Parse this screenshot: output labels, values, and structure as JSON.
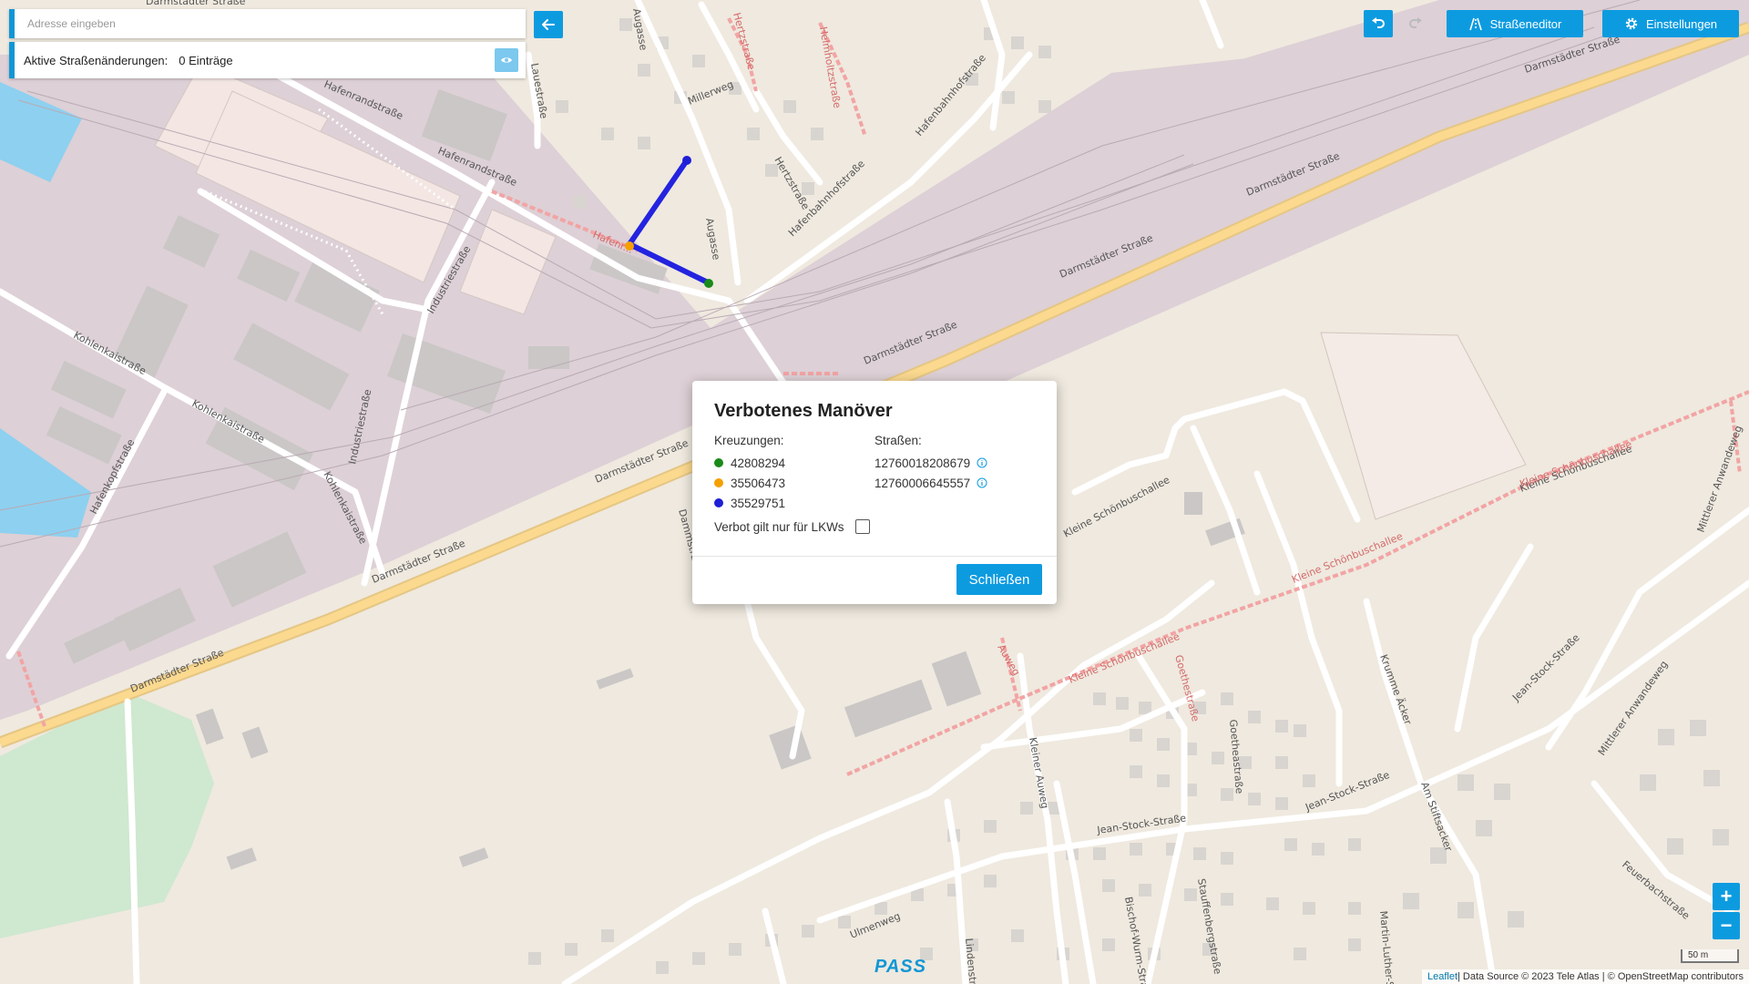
{
  "search": {
    "placeholder": "Adresse eingeben"
  },
  "changes": {
    "label": "Aktive Straßenänderungen:",
    "count": "0 Einträge"
  },
  "toolbar": {
    "editor_label": "Straßeneditor",
    "settings_label": "Einstellungen"
  },
  "modal": {
    "title": "Verbotenes Manöver",
    "crossings_label": "Kreuzungen:",
    "crossings": [
      {
        "id": "42808294",
        "color": "#1a8a1a"
      },
      {
        "id": "35506473",
        "color": "#f5a000"
      },
      {
        "id": "35529751",
        "color": "#1f1fd6"
      }
    ],
    "streets_label": "Straßen:",
    "streets": [
      "12760018208679",
      "12760006645557"
    ],
    "truck_only_label": "Verbot gilt nur für LKWs",
    "close_label": "Schließen"
  },
  "map_labels": {
    "l01": "Hafenrandstraße",
    "l02": "Hafenrandstraße",
    "l03": "Hafenr...",
    "l04": "Industriestraße",
    "l05": "Industriestraße",
    "l06": "Kohlenkaistraße",
    "l07": "Kohlenkaistraße",
    "l08": "Kohlenkaistraße",
    "l09": "Hafenkopfstraße",
    "l10": "Darmstädter Straße",
    "l11": "Darmstädter Straße",
    "l12": "Darmstädter Straße",
    "l13": "Darmstädter Straße",
    "l14": "Darmstädter Straße",
    "l15": "Darmstädter Straße",
    "l16": "Darmstädter Straße",
    "l17": "Darmstädter Straße",
    "l18": "Augasse",
    "l19": "Augasse",
    "l20": "Millerweg",
    "l21": "Hertzstraße",
    "l22": "Hertzstraße",
    "l23": "Helmholtzstraße",
    "l24": "Hafenbahnhofstraße",
    "l25": "Hafenbahnhofstraße",
    "l26": "Lauestraße",
    "l27": "Kleine Schönbuschallee",
    "l28": "Kleine Schönbuschallee",
    "l29": "Kleine Schönbuschallee",
    "l30": "Kleine Schönbuschallee",
    "l31": "Kleine Schönbuschallee",
    "l32": "Auweg",
    "l33": "Kleiner Auweg",
    "l34": "Goethestraße",
    "l35": "Goetheastraße",
    "l36": "Jean-Stock-Straße",
    "l37": "Jean-Stock-Straße",
    "l38": "Jean-Stock-Straße",
    "l39": "Krumme Äcker",
    "l40": "Am Stiftsacker",
    "l41": "Mittlerer Anwandeweg",
    "l42": "Mittlerer Anwandeweg",
    "l43": "Feuerbachstraße",
    "l44": "Ulmenweg",
    "l45": "Bischof-Wurm-Straße",
    "l46": "Stauffenbergstraße",
    "l47": "Martin-Luther-Straße",
    "l48": "Dammstraße",
    "l49": "Lindenstraße"
  },
  "scale": "50 m",
  "attribution": {
    "leaflet": "Leaflet",
    "text": " | Data Source © 2023 Tele Atlas | © OpenStreetMap contributors"
  },
  "logo": "PASS"
}
